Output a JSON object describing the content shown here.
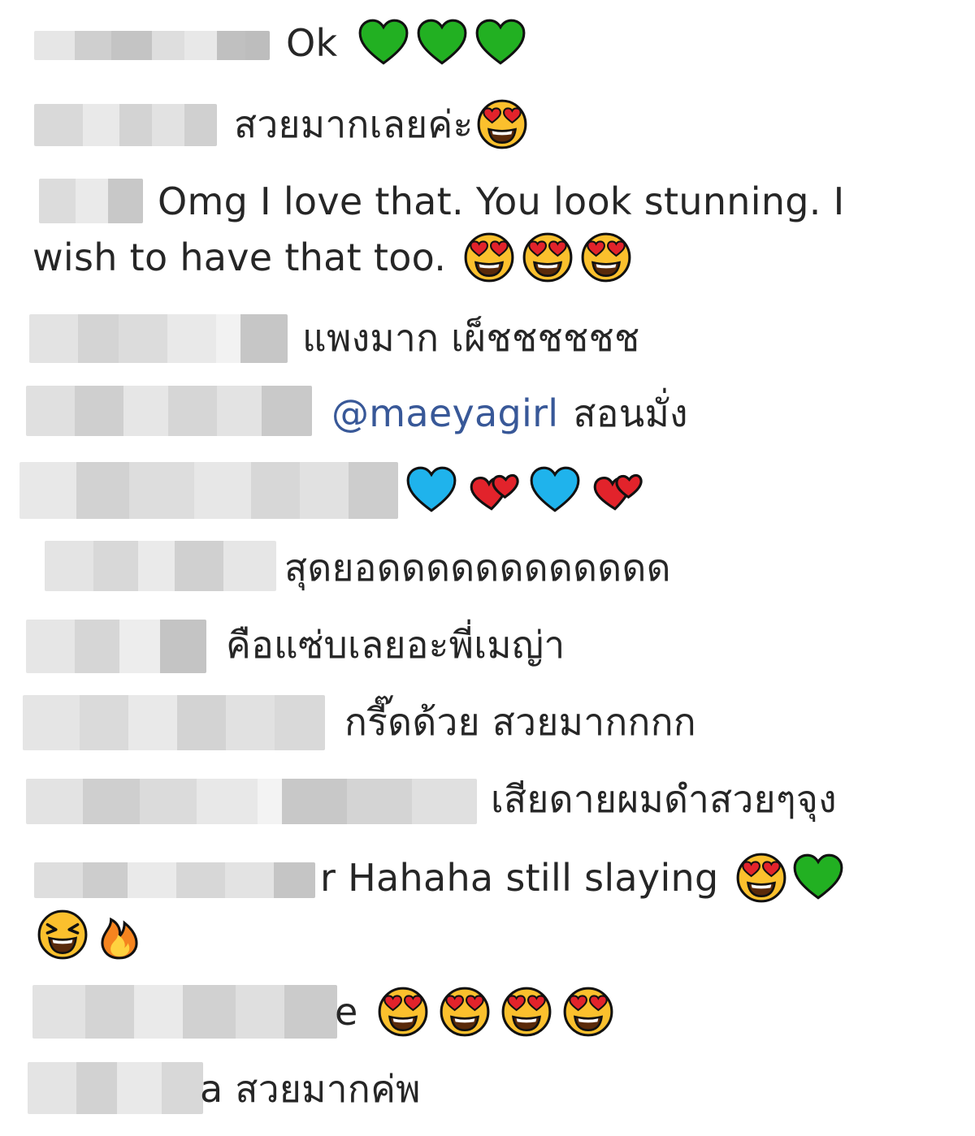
{
  "comments": [
    {
      "text": "Ok",
      "emojis": [
        "green-heart-icon",
        "green-heart-icon",
        "green-heart-icon"
      ]
    },
    {
      "text": "สวยมากเลยค่ะ",
      "emojis": [
        "heart-eyes-icon"
      ]
    },
    {
      "text_line1": "Omg I love that. You look stunning. I",
      "text_line2": "wish to have that too.",
      "emojis": [
        "heart-eyes-icon",
        "heart-eyes-icon",
        "heart-eyes-icon"
      ]
    },
    {
      "text": "แพงมาก เผ็ชชชชชช"
    },
    {
      "mention": "@maeyagirl",
      "text": "สอนมั่ง"
    },
    {
      "text": "",
      "emojis": [
        "blue-heart-icon",
        "two-hearts-icon",
        "blue-heart-icon",
        "two-hearts-icon"
      ]
    },
    {
      "text": "สุดยอดดดดดดดดดดดด"
    },
    {
      "text": "คือแซ่บเลยอะพี่เมญ่า"
    },
    {
      "text": "กรี๊ดด้วย สวยมากกกก"
    },
    {
      "text": "เสียดายผมดำสวยๆจุง"
    },
    {
      "text_line1": "r Hahaha still slaying",
      "emojis_line1": [
        "heart-eyes-icon",
        "green-heart-icon"
      ],
      "emojis_line2": [
        "laughing-squint-icon",
        "fire-icon"
      ]
    },
    {
      "text": "e",
      "emojis": [
        "heart-eyes-icon",
        "heart-eyes-icon",
        "heart-eyes-icon",
        "heart-eyes-icon"
      ]
    },
    {
      "text": "a สวยมากค่พ"
    }
  ],
  "colors": {
    "text": "#262626",
    "mention": "#385898",
    "green_heart": "#22b022",
    "blue_heart": "#1fb3ec",
    "red_heart": "#e2232b",
    "heart_eyes_face": "#fbc02d",
    "blur_light": "#ececec",
    "blur_dark": "#bdbdbd"
  }
}
